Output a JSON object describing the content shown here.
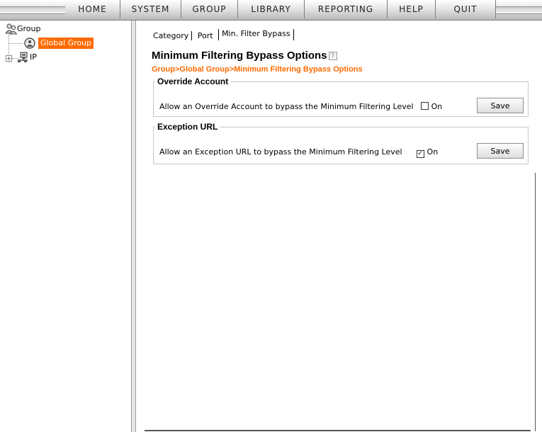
{
  "menu": {
    "items": [
      {
        "label": "HOME"
      },
      {
        "label": "SYSTEM"
      },
      {
        "label": "GROUP"
      },
      {
        "label": "LIBRARY"
      },
      {
        "label": "REPORTING"
      },
      {
        "label": "HELP"
      },
      {
        "label": "QUIT"
      }
    ]
  },
  "tree": {
    "root_label": "Group",
    "root_icon": "users-group-icon",
    "selected_label": "Global Group",
    "selected_icon": "globe-group-icon",
    "ip_label": "IP",
    "ip_icon": "network-computer-icon",
    "expander_symbol": "+",
    "selection_color": "#ff6a00"
  },
  "tabs": [
    {
      "label": "Category"
    },
    {
      "label": "Port"
    },
    {
      "label": "Min. Filter Bypass",
      "active": true
    }
  ],
  "page": {
    "title": "Minimum Filtering Bypass Options",
    "help_icon": "help-icon",
    "breadcrumb": "Group>Global Group>Minimum Filtering Bypass Options",
    "breadcrumb_color": "#ff6a00"
  },
  "sections": {
    "override": {
      "legend": "Override Account",
      "text": "Allow an Override Account to bypass the Minimum Filtering Level",
      "checkbox_label": "On",
      "checked": false,
      "save_label": "Save"
    },
    "exception": {
      "legend": "Exception URL",
      "text": "Allow an Exception URL to bypass the Minimum Filtering Level",
      "checkbox_label": "On",
      "checked": true,
      "save_label": "Save"
    }
  }
}
